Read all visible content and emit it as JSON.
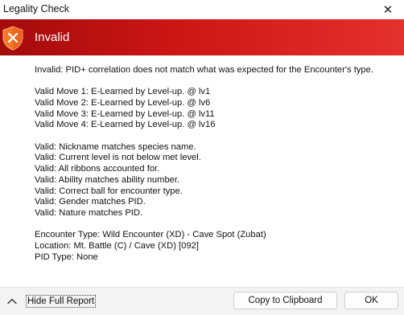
{
  "window": {
    "title": "Legality Check",
    "close_glyph": "✕"
  },
  "banner": {
    "status": "Invalid",
    "icon": "shield-x-icon",
    "color": "#cc1515"
  },
  "report": {
    "summary": "Invalid: PID+ correlation does not match what was expected for the Encounter's type.",
    "moves": [
      "Valid Move 1: E-Learned by Level-up. @ lv1",
      "Valid Move 2: E-Learned by Level-up. @ lv6",
      "Valid Move 3: E-Learned by Level-up. @ lv11",
      "Valid Move 4: E-Learned by Level-up. @ lv16"
    ],
    "checks": [
      "Valid: Nickname matches species name.",
      "Valid: Current level is not below met level.",
      "Valid: All ribbons accounted for.",
      "Valid: Ability matches ability number.",
      "Valid: Correct ball for encounter type.",
      "Valid: Gender matches PID.",
      "Valid: Nature matches PID."
    ],
    "encounter": [
      "Encounter Type: Wild Encounter (XD) - Cave Spot (Zubat)",
      "Location: Mt. Battle (C) / Cave (XD) [092]",
      "PID Type: None"
    ]
  },
  "footer": {
    "toggle_label": "Hide Full Report",
    "toggle_icon": "chevron-up-icon",
    "copy_label": "Copy to Clipboard",
    "ok_label": "OK"
  }
}
